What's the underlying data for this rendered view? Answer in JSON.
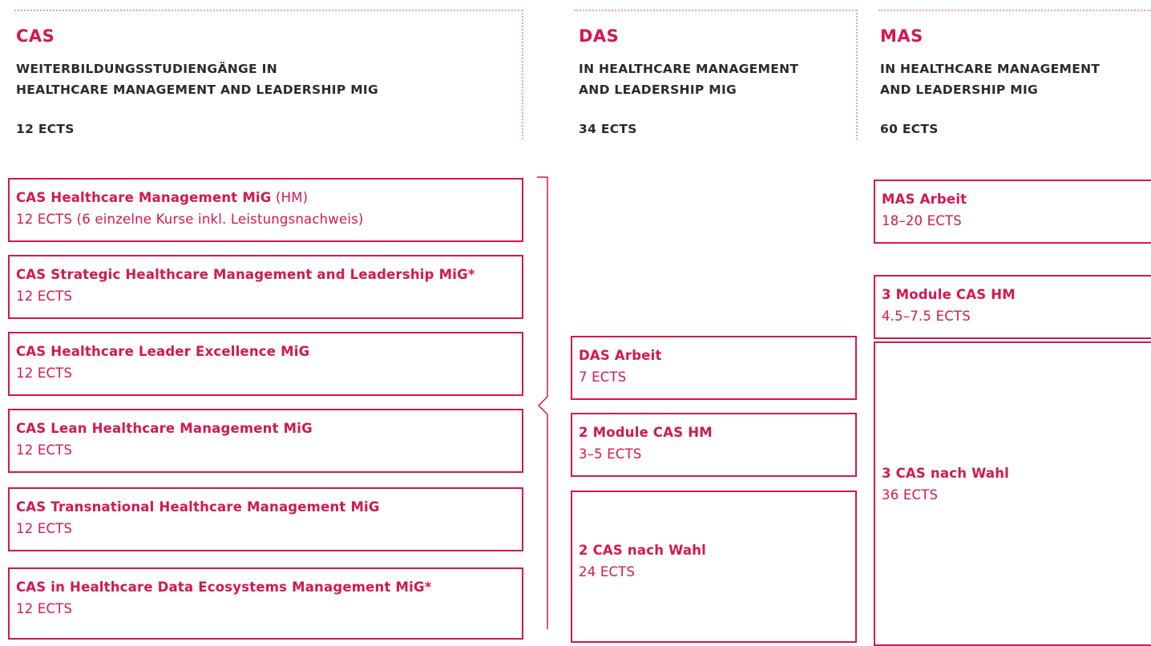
{
  "columns": {
    "cas": {
      "title": "CAS",
      "subtitle_line1": "WEITERBILDUNGSSTUDIENGÄNGE IN",
      "subtitle_line2": "HEALTHCARE MANAGEMENT AND LEADERSHIP MIG",
      "ects": "12 ECTS"
    },
    "das": {
      "title": "DAS",
      "subtitle_line1": "IN HEALTHCARE MANAGEMENT",
      "subtitle_line2": "AND LEADERSHIP MIG",
      "ects": "34 ECTS"
    },
    "mas": {
      "title": "MAS",
      "subtitle_line1": "IN HEALTHCARE MANAGEMENT",
      "subtitle_line2": "AND LEADERSHIP MIG",
      "ects": "60 ECTS"
    }
  },
  "cas_boxes": [
    {
      "title": "CAS Healthcare Management MiG",
      "suffix": " (HM)",
      "sub": "12 ECTS (6 einzelne Kurse inkl. Leistungsnachweis)"
    },
    {
      "title": "CAS Strategic Healthcare Management and Leadership MiG*",
      "suffix": "",
      "sub": "12 ECTS"
    },
    {
      "title": "CAS Healthcare Leader Excellence MiG",
      "suffix": "",
      "sub": "12 ECTS"
    },
    {
      "title": "CAS Lean Healthcare Management MiG",
      "suffix": "",
      "sub": "12 ECTS"
    },
    {
      "title": "CAS Transnational Healthcare Management MiG",
      "suffix": "",
      "sub": "12 ECTS"
    },
    {
      "title": "CAS in Healthcare Data Ecosystems Management MiG*",
      "suffix": "",
      "sub": "12 ECTS"
    }
  ],
  "das_boxes": [
    {
      "title": "DAS Arbeit",
      "sub": "7 ECTS"
    },
    {
      "title": "2 Module CAS HM",
      "sub": "3–5 ECTS"
    },
    {
      "title": "2 CAS nach Wahl",
      "sub": "24 ECTS"
    }
  ],
  "mas_boxes": [
    {
      "title": "MAS Arbeit",
      "sub": "18–20 ECTS"
    },
    {
      "title": "3 Module CAS HM",
      "sub": "4.5–7.5 ECTS"
    },
    {
      "title": "3 CAS nach Wahl",
      "sub": "36 ECTS"
    }
  ],
  "colors": {
    "accent": "#d4184d",
    "text": "#2a2a2a",
    "dotted": "#e0a7b8"
  }
}
